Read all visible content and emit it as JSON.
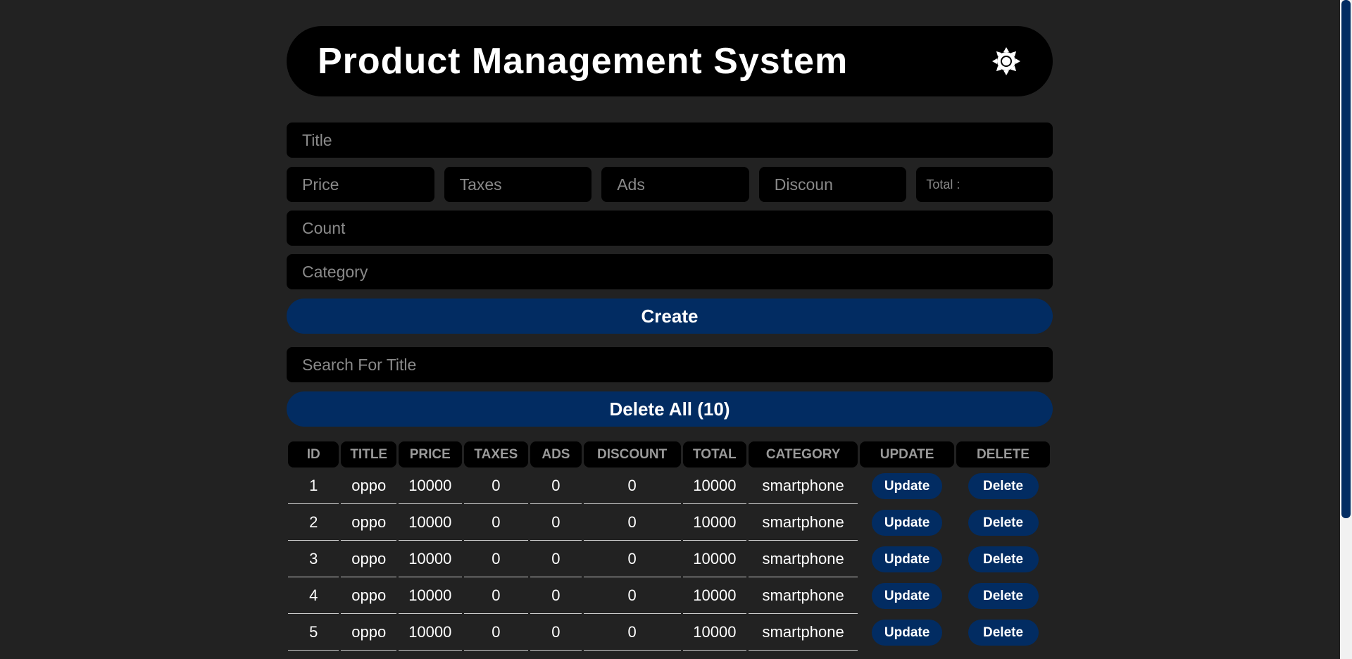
{
  "header": {
    "title": "Product Management System",
    "theme_icon": "sun-gear-icon"
  },
  "form": {
    "title_placeholder": "Title",
    "price_placeholder": "Price",
    "taxes_placeholder": "Taxes",
    "ads_placeholder": "Ads",
    "discount_placeholder": "Discoun",
    "total_label": "Total :",
    "count_placeholder": "Count",
    "category_placeholder": "Category",
    "create_label": "Create"
  },
  "search": {
    "placeholder": "Search For Title"
  },
  "delete_all_label": "Delete All (10)",
  "table": {
    "headers": [
      "ID",
      "TITLE",
      "PRICE",
      "TAXES",
      "ADS",
      "DISCOUNT",
      "TOTAL",
      "CATEGORY",
      "UPDATE",
      "DELETE"
    ],
    "update_label": "Update",
    "delete_label": "Delete",
    "rows": [
      {
        "id": "1",
        "title": "oppo",
        "price": "10000",
        "taxes": "0",
        "ads": "0",
        "discount": "0",
        "total": "10000",
        "category": "smartphone"
      },
      {
        "id": "2",
        "title": "oppo",
        "price": "10000",
        "taxes": "0",
        "ads": "0",
        "discount": "0",
        "total": "10000",
        "category": "smartphone"
      },
      {
        "id": "3",
        "title": "oppo",
        "price": "10000",
        "taxes": "0",
        "ads": "0",
        "discount": "0",
        "total": "10000",
        "category": "smartphone"
      },
      {
        "id": "4",
        "title": "oppo",
        "price": "10000",
        "taxes": "0",
        "ads": "0",
        "discount": "0",
        "total": "10000",
        "category": "smartphone"
      },
      {
        "id": "5",
        "title": "oppo",
        "price": "10000",
        "taxes": "0",
        "ads": "0",
        "discount": "0",
        "total": "10000",
        "category": "smartphone"
      }
    ]
  },
  "colors": {
    "background": "#222222",
    "panel": "#000000",
    "accent": "#022c62"
  }
}
